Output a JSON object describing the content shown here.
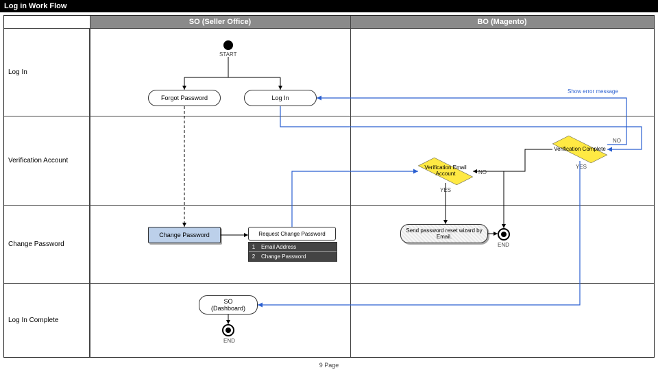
{
  "title": "Log in Work Flow",
  "columns": {
    "left": "",
    "so": "SO (Seller Office)",
    "bo": "BO (Magento)"
  },
  "rows": {
    "login": "Log In",
    "verify": "Verification Account",
    "changepw": "Change Password",
    "complete": "Log In Complete"
  },
  "nodes": {
    "start": "START",
    "forgot": "Forgot Password",
    "loginBox": "Log In",
    "verifComplete": "Verification Complete",
    "verifEmail": "Verification Email Account",
    "changePw": "Change Password",
    "reqChange": "Request Change Password",
    "sendReset": "Send password reset wizard by Email.",
    "soDash": "SO\n(Dashboard)",
    "end": "END"
  },
  "requestTable": {
    "row1": {
      "num": "1",
      "text": "Email Address"
    },
    "row2": {
      "num": "2",
      "text": "Change Password"
    }
  },
  "edges": {
    "yes": "YES",
    "no": "NO",
    "showError": "Show error message"
  },
  "footer": "9 Page"
}
